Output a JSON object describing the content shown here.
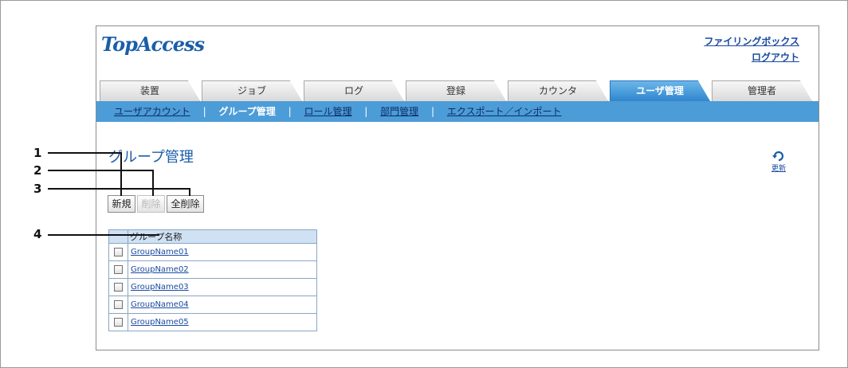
{
  "header": {
    "logo": "TopAccess",
    "links": [
      "ファイリングボックス",
      "ログアウト"
    ]
  },
  "tabs": [
    {
      "label": "装置",
      "active": false
    },
    {
      "label": "ジョブ",
      "active": false
    },
    {
      "label": "ログ",
      "active": false
    },
    {
      "label": "登録",
      "active": false
    },
    {
      "label": "カウンタ",
      "active": false
    },
    {
      "label": "ユーザ管理",
      "active": true
    },
    {
      "label": "管理者",
      "active": false
    }
  ],
  "subnav": {
    "items": [
      "ユーザアカウント",
      "グループ管理",
      "ロール管理",
      "部門管理",
      "エクスポート／インポート"
    ],
    "separator": "|"
  },
  "main": {
    "title": "グループ管理",
    "refresh_label": "更新",
    "buttons": {
      "new": "新規",
      "delete": "削除",
      "delete_all": "全削除"
    },
    "table": {
      "header": "グループ名称",
      "rows": [
        "GroupName01",
        "GroupName02",
        "GroupName03",
        "GroupName04",
        "GroupName05"
      ]
    }
  },
  "callouts": [
    "1",
    "2",
    "3",
    "4"
  ],
  "colors": {
    "accent": "#4c9cd8",
    "active_tab": "#2f86cc",
    "link": "#1a4aa0"
  }
}
